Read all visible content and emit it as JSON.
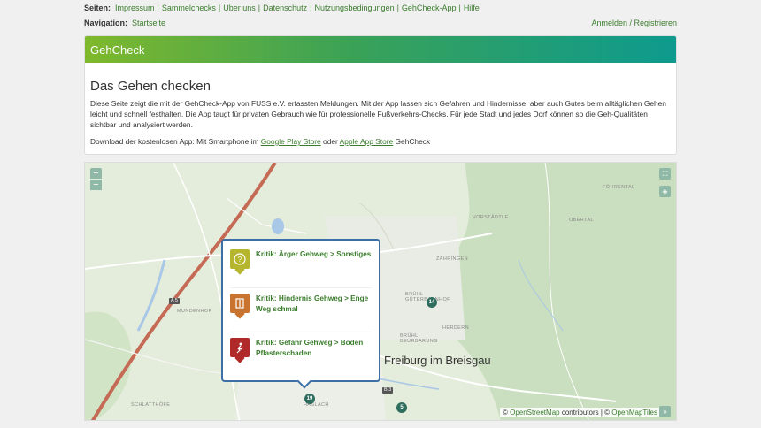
{
  "header": {
    "pages_label": "Seiten:",
    "pages": [
      "Impressum",
      "Sammelchecks",
      "Über uns",
      "Datenschutz",
      "Nutzungsbedingungen",
      "GehCheck-App",
      "Hilfe"
    ],
    "nav_label": "Navigation:",
    "nav_home": "Startseite",
    "auth": "Anmelden / Registrieren"
  },
  "card": {
    "title": "GehCheck",
    "heading": "Das Gehen checken",
    "intro": "Diese Seite zeigt die mit der GehCheck-App von FUSS e.V. erfassten Meldungen. Mit der App lassen sich Gefahren und Hindernisse, aber auch Gutes beim alltäglichen Gehen leicht und schnell festhalten. Die App taugt für privaten Gebrauch wie für professionelle Fußverkehrs-Checks. Für jede Stadt und jedes Dorf können so die Geh-Qualitäten sichtbar und analysiert werden.",
    "download_prefix": "Download der kostenlosen App: Mit Smartphone im ",
    "google_play": "Google Play Store",
    "download_or": " oder ",
    "apple_store": "Apple App Store",
    "download_suffix": " GehCheck"
  },
  "map": {
    "zoom_in": "+",
    "zoom_out": "−",
    "city": "Freiburg im Breisgau",
    "places": [
      "FÖHRENTAL",
      "VORSTÄDTLE",
      "OBERTAL",
      "ZÄHRINGEN",
      "BRÜHL-GÜTERBAHNHOF",
      "BRÜHL-BEURBARUNG",
      "HERDERN",
      "MUNDENHOF",
      "SCHLATTHÖFE",
      "HASLACH",
      "LEHEN",
      "Reutebach",
      "Dreisam"
    ],
    "roads": [
      "A 5",
      "B 3",
      "B 31"
    ],
    "markers": [
      "14",
      "19",
      "5"
    ],
    "attribution_prefix": "© ",
    "osm": "OpenStreetMap",
    "attribution_mid": " contributors | © ",
    "omt": "OpenMapTiles",
    "popup_items": [
      {
        "text": "Kritik: Ärger Gehweg > Sonstiges",
        "color": "#b5b52e",
        "icon": "question-icon"
      },
      {
        "text": "Kritik: Hindernis Gehweg > Enge Weg schmal",
        "color": "#c8742e",
        "icon": "narrow-path-icon"
      },
      {
        "text": "Kritik: Gefahr Gehweg > Boden Pflasterschaden",
        "color": "#b02a2a",
        "icon": "trip-hazard-icon"
      }
    ]
  }
}
